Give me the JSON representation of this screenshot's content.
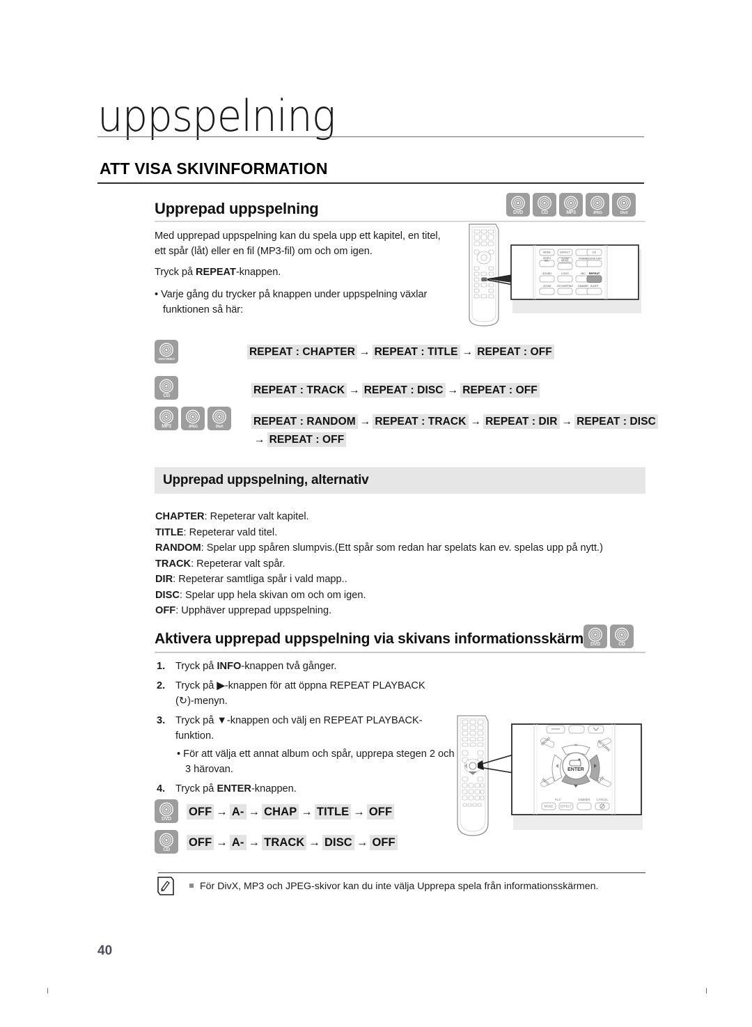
{
  "page": {
    "chapter_title": "uppspelning",
    "section_heading": "ATT VISA SKIVINFORMATION",
    "page_number": "40"
  },
  "repeat_playback": {
    "heading": "Upprepad uppspelning",
    "disc_badges": [
      {
        "label": "DVD",
        "icon": "disc-icon"
      },
      {
        "label": "CD",
        "icon": "disc-icon"
      },
      {
        "label": "MP3",
        "icon": "disc-icon"
      },
      {
        "label": "JPEG",
        "icon": "disc-icon"
      },
      {
        "label": "DivX",
        "icon": "disc-icon"
      }
    ],
    "intro_paragraph": "Med upprepad uppspelning kan du spela upp ett kapitel, en titel, ett spår (låt) eller en fil (MP3-fil) om och om igen.",
    "instruction_line_prefix": "Tryck på ",
    "instruction_button": "REPEAT",
    "instruction_line_suffix": "-knappen.",
    "bullet_note": "Varje gång du trycker på knappen under uppspelning växlar funktionen så här:"
  },
  "repeat_sequences": [
    {
      "badges": [
        {
          "label": "DVD-VIDEO"
        }
      ],
      "steps": [
        "REPEAT : CHAPTER",
        "REPEAT : TITLE",
        "REPEAT : OFF"
      ],
      "arrow": "→"
    },
    {
      "badges": [
        {
          "label": "CD"
        }
      ],
      "steps": [
        "REPEAT : TRACK",
        "REPEAT : DISC",
        "REPEAT : OFF"
      ],
      "arrow": "→"
    },
    {
      "badges": [
        {
          "label": "MP3"
        },
        {
          "label": "JPEG"
        },
        {
          "label": "DivX"
        }
      ],
      "steps": [
        "REPEAT : RANDOM",
        "REPEAT : TRACK",
        "REPEAT : DIR",
        "REPEAT : DISC"
      ],
      "steps_wrapped": [
        "REPEAT : OFF"
      ],
      "arrow": "→"
    }
  ],
  "options_band": {
    "title": "Upprepad uppspelning, alternativ",
    "definitions": [
      {
        "term": "CHAPTER",
        "text": ": Repeterar valt kapitel."
      },
      {
        "term": "TITLE",
        "text": ": Repeterar vald titel."
      },
      {
        "term": "RANDOM",
        "text": ": Spelar upp spåren slumpvis.(Ett spår som redan har spelats kan ev. spelas upp på nytt.)"
      },
      {
        "term": "TRACK",
        "text": ": Repeterar valt spår."
      },
      {
        "term": "DIR",
        "text": ": Repeterar samtliga spår i vald mapp.."
      },
      {
        "term": "DISC",
        "text": ": Spelar upp hela skivan om och om igen."
      },
      {
        "term": "OFF",
        "text": ": Upphäver upprepad uppspelning."
      }
    ]
  },
  "info_screen_section": {
    "heading": "Aktivera upprepad uppspelning via skivans informationsskärm",
    "disc_badges": [
      {
        "label": "DVD"
      },
      {
        "label": "CD"
      }
    ],
    "steps": [
      {
        "num": "1.",
        "parts": [
          {
            "t": "Tryck på ",
            "b": false
          },
          {
            "t": "INFO",
            "b": true
          },
          {
            "t": "-knappen två gånger.",
            "b": false
          }
        ]
      },
      {
        "num": "2.",
        "parts": [
          {
            "t": "Tryck på ",
            "b": false
          },
          {
            "t": "▶",
            "b": true
          },
          {
            "t": "-knappen för att öppna REPEAT PLAYBACK",
            "b": false
          }
        ],
        "line2": "(↻)-menyn."
      },
      {
        "num": "3.",
        "parts": [
          {
            "t": "Tryck på ",
            "b": false
          },
          {
            "t": "▼",
            "b": true
          },
          {
            "t": "-knappen och välj en REPEAT PLAYBACK-",
            "b": false
          }
        ],
        "line2": "funktion.",
        "sub_bullet": "• För att välja ett annat album och spår, upprepa stegen 2 och 3 härovan."
      },
      {
        "num": "4.",
        "parts": [
          {
            "t": "Tryck på ",
            "b": false
          },
          {
            "t": "ENTER",
            "b": true
          },
          {
            "t": "-knappen.",
            "b": false
          }
        ]
      }
    ],
    "sequences": [
      {
        "badges": [
          {
            "label": "DVD"
          }
        ],
        "steps": [
          "OFF",
          "A-",
          "CHAP",
          "TITLE",
          "OFF"
        ],
        "arrow": "→"
      },
      {
        "badges": [
          {
            "label": "CD"
          }
        ],
        "steps": [
          "OFF",
          "A-",
          "TRACK",
          "DISC",
          "OFF"
        ],
        "arrow": "→"
      }
    ]
  },
  "note": {
    "bullet": "▪",
    "text": "För DivX, MP3 och JPEG-skivor kan du inte välja Upprepa spela från informationsskärmen."
  },
  "remote_top": {
    "caption_buttons_row1": [
      "MODE",
      "EFFECT",
      "",
      "CD"
    ],
    "caption_buttons_row2": [
      "VIDEO SEL.",
      "SLOW",
      "FRAME",
      "SOUND EDIT"
    ],
    "caption_buttons_row2b": [
      "MOVE"
    ],
    "caption_buttons_row3": [
      "SOUND",
      "LOGO",
      "MIC",
      "REPEAT"
    ],
    "caption_buttons_row4": [
      "ZOOM",
      "CO.SKIPPING",
      "DIMMER",
      "SLEEP"
    ],
    "highlighted_button": "REPEAT"
  },
  "remote_bottom": {
    "labels": [
      "MENU",
      "RETURN",
      "ENTER",
      "INFO",
      "EXIT",
      "MODE",
      "EFFECT",
      "DIMMER",
      "CANCEL",
      "PL II"
    ],
    "highlighted_buttons": [
      "right-arrow",
      "down-arrow"
    ]
  },
  "colors": {
    "badge_grey": "#9d9d9d",
    "highlight_grey": "#e3e3e3",
    "band_grey": "#e6e6e6",
    "page_number": "#4c4f5e"
  }
}
